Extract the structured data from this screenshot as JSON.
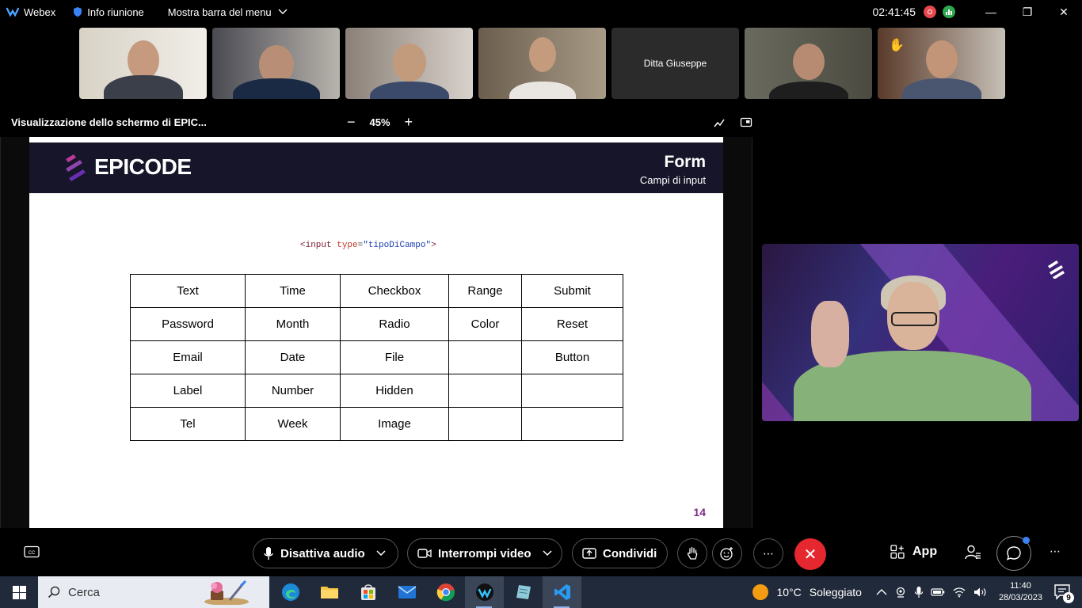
{
  "top_bar": {
    "app_name": "Webex",
    "meeting_info": "Info riunione",
    "menu_bar": "Mostra barra del menu",
    "clock": "02:41:45",
    "colors": {
      "record": "#e5484d",
      "stats": "#2fa84f"
    }
  },
  "participants": [
    {
      "kind": "video",
      "icon": "person-video"
    },
    {
      "kind": "video",
      "icon": "person-video"
    },
    {
      "kind": "video",
      "icon": "person-video"
    },
    {
      "kind": "video",
      "icon": "person-video"
    },
    {
      "kind": "name",
      "name": "Ditta Giuseppe"
    },
    {
      "kind": "video",
      "icon": "person-video"
    },
    {
      "kind": "video",
      "icon": "person-video",
      "raised_hand": true
    }
  ],
  "share": {
    "title": "Visualizzazione dello schermo di EPIC...",
    "zoom": "45%"
  },
  "slide": {
    "brand": "EPICODE",
    "title": "Form",
    "subtitle": "Campi di input",
    "code": {
      "open": "<input ",
      "attr": "type",
      "eq": "=",
      "value": "\"tipoDiCampo\"",
      "close": ">"
    },
    "table": [
      [
        "Text",
        "Time",
        "Checkbox",
        "Range",
        "Submit"
      ],
      [
        "Password",
        "Month",
        "Radio",
        "Color",
        "Reset"
      ],
      [
        "Email",
        "Date",
        "File",
        "",
        "Button"
      ],
      [
        "Label",
        "Number",
        "Hidden",
        "",
        ""
      ],
      [
        "Tel",
        "Week",
        "Image",
        "",
        ""
      ]
    ],
    "page_number": "14"
  },
  "controls": {
    "mute": "Disattiva audio",
    "stop_video": "Interrompi video",
    "share": "Condividi",
    "apps": "App",
    "end_color": "#e5282f"
  },
  "taskbar": {
    "search_placeholder": "Cerca",
    "weather_temp": "10°C",
    "weather_desc": "Soleggiato",
    "time": "11:40",
    "date": "28/03/2023",
    "notifications": "9"
  }
}
